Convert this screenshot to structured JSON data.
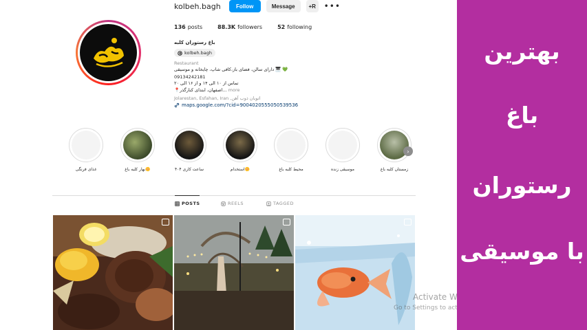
{
  "profile": {
    "username": "kolbeh.bagh",
    "follow_label": "Follow",
    "message_label": "Message",
    "add_user_label": "+R",
    "more_label": "•••",
    "posts_count": "136",
    "posts_label": "posts",
    "followers_count": "88.3K",
    "followers_label": "followers",
    "following_count": "52",
    "following_label": "following",
    "full_name": "باغ رستوران کلبه",
    "threads_handle": "kolbeh.bagh",
    "category": "Restaurant",
    "bio_line1": "دارای سالن، فضای باز،کافی شاپ، چایخانه و موسیقی 🎹 💚",
    "bio_line2": "09134242181",
    "bio_line3": "تماس از ۱۰ الی ۱۴ و از ۱۶ الی ۲۰",
    "bio_line4": "📍اصفهان، ابتدای کنارگذر...",
    "bio_more": "more",
    "location": "Jolarestan, Esfahan, Iran ,اتوبان ذوب آهن",
    "link": "maps.google.com/?cid=9004020555050539536"
  },
  "highlights": [
    {
      "label": "غذای فرنگی"
    },
    {
      "label": "بهار کلبه باغ🌼"
    },
    {
      "label": "ساعت کاری ۴۰۴"
    },
    {
      "label": "استخدام🌼"
    },
    {
      "label": "محیط کلبه باغ"
    },
    {
      "label": "موسیقی زنده"
    },
    {
      "label": "زمستان کلبه باغ"
    }
  ],
  "tabs": {
    "posts": "POSTS",
    "reels": "REELS",
    "tagged": "TAGGED"
  },
  "windows_watermark": {
    "line1": "Activate Windows",
    "line2": "Go to Settings to activate Windows."
  },
  "banner": {
    "line1": "بهترین",
    "line2": "باغ",
    "line3": "رستوران",
    "line4": "با موسیقی",
    "background": "#b32ea0"
  },
  "colors": {
    "accent": "#0095f6",
    "link": "#00376b"
  }
}
